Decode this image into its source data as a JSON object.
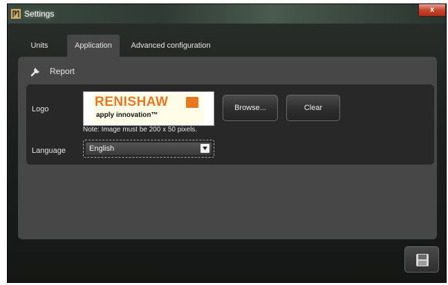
{
  "window": {
    "title": "Settings",
    "close_label": "x"
  },
  "tabs": [
    {
      "label": "Units",
      "active": false
    },
    {
      "label": "Application",
      "active": true
    },
    {
      "label": "Advanced configuration",
      "active": false
    }
  ],
  "report": {
    "section_title": "Report",
    "section_icon": "wrench-icon",
    "logo_label": "Logo",
    "logo_image": {
      "brand_text": "RENISHAW",
      "tagline": "apply innovation™"
    },
    "logo_note": "Note: Image must be 200 x 50 pixels.",
    "browse_label": "Browse...",
    "clear_label": "Clear",
    "language_label": "Language",
    "language_value": "English"
  },
  "footer": {
    "save_icon": "save-icon"
  },
  "colors": {
    "brand_orange": "#e87722",
    "panel": "#474747",
    "inner_panel": "#282828"
  }
}
